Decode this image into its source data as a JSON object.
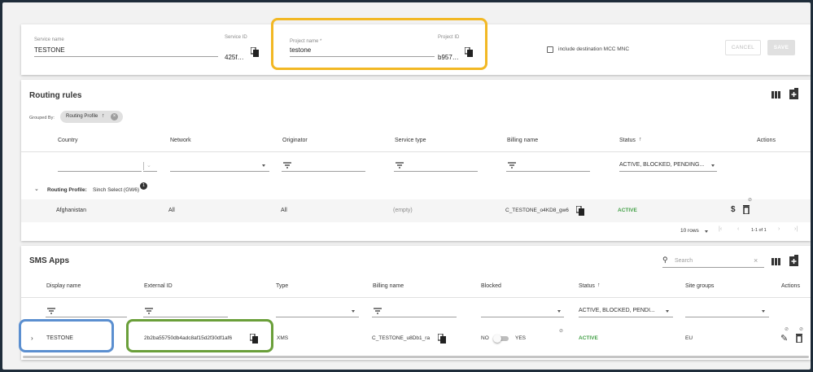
{
  "service": {
    "service_name_label": "Service name",
    "service_name_value": "TESTONE",
    "service_id_label": "Service ID",
    "service_id_value": "425f…",
    "project_name_label": "Project name *",
    "project_name_value": "testone",
    "project_id_label": "Project ID",
    "project_id_value": "b957…",
    "include_mcc_label": "include destination MCC MNC",
    "cancel_label": "CANCEL",
    "save_label": "SAVE"
  },
  "routing": {
    "title": "Routing rules",
    "grouped_by_label": "Grouped By:",
    "chip_label": "Routing Profile",
    "columns": [
      "Country",
      "Network",
      "Originator",
      "Service type",
      "Billing name",
      "Status",
      "Actions"
    ],
    "status_filter": "ACTIVE, BLOCKED, PENDING...",
    "group_label_bold": "Routing Profile:",
    "group_label_value": "Sinch Select (GW6)",
    "group_count": "1",
    "row": {
      "country": "Afghanistan",
      "network": "All",
      "originator": "All",
      "service_type": "(empty)",
      "billing_name": "C_TESTONE_o4KD8_gw6",
      "status": "ACTIVE"
    },
    "rows_per_page": "10 rows",
    "pagination": "1-1 of 1"
  },
  "sms_apps": {
    "title": "SMS Apps",
    "search_placeholder": "Search",
    "columns": [
      "Display name",
      "External ID",
      "Type",
      "Billing name",
      "Blocked",
      "Status",
      "Site groups",
      "Actions"
    ],
    "status_filter": "ACTIVE, BLOCKED, PENDI...",
    "row": {
      "display_name": "TESTONE",
      "external_id": "2b2ba55750db4adc8af15d2f30df1af6",
      "type": "XMS",
      "billing_name": "C_TESTONE_u8Db1_ra",
      "blocked_no": "NO",
      "blocked_yes": "YES",
      "status": "ACTIVE",
      "site_group": "EU"
    }
  },
  "colors": {
    "highlight_yellow": "#f2b824",
    "highlight_blue": "#5b8fd0",
    "highlight_green": "#6a9f3a",
    "active_green": "#43a047"
  }
}
